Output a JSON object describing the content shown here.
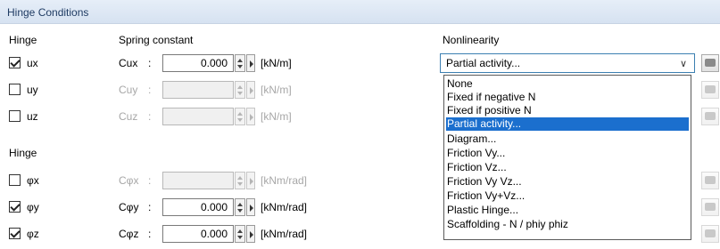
{
  "header": {
    "title": "Hinge Conditions"
  },
  "columns": {
    "hinge": "Hinge",
    "spring": "Spring constant",
    "nonlinearity": "Nonlinearity"
  },
  "group2": {
    "title": "Hinge"
  },
  "rows": [
    {
      "hinge": "ux",
      "checked": true,
      "constant": "Cux",
      "value": "0.000",
      "unit": "[kN/m]",
      "enabled": true
    },
    {
      "hinge": "uy",
      "checked": false,
      "constant": "Cuy",
      "value": "",
      "unit": "[kN/m]",
      "enabled": false
    },
    {
      "hinge": "uz",
      "checked": false,
      "constant": "Cuz",
      "value": "",
      "unit": "[kN/m]",
      "enabled": false
    },
    {
      "hinge": "φx",
      "checked": false,
      "constant": "Cφx",
      "value": "",
      "unit": "[kNm/rad]",
      "enabled": false
    },
    {
      "hinge": "φy",
      "checked": true,
      "constant": "Cφy",
      "value": "0.000",
      "unit": "[kNm/rad]",
      "enabled": true
    },
    {
      "hinge": "φz",
      "checked": true,
      "constant": "Cφz",
      "value": "0.000",
      "unit": "[kNm/rad]",
      "enabled": true
    }
  ],
  "colon": ":",
  "nonlinearity_select": {
    "value": "Partial activity...",
    "options": [
      "None",
      "Fixed if negative N",
      "Fixed if positive N",
      "Partial activity...",
      "Diagram...",
      "Friction Vy...",
      "Friction Vz...",
      "Friction Vy Vz...",
      "Friction Vy+Vz...",
      "Plastic Hinge...",
      "Scaffolding - N / phiy phiz"
    ],
    "selected_index": 3
  },
  "colors": {
    "header_text": "#1f3b63",
    "selection": "#1b6fce",
    "disabled_text": "#a7a7a7"
  },
  "icons": {
    "side_button": "edit-dialog-icon"
  }
}
